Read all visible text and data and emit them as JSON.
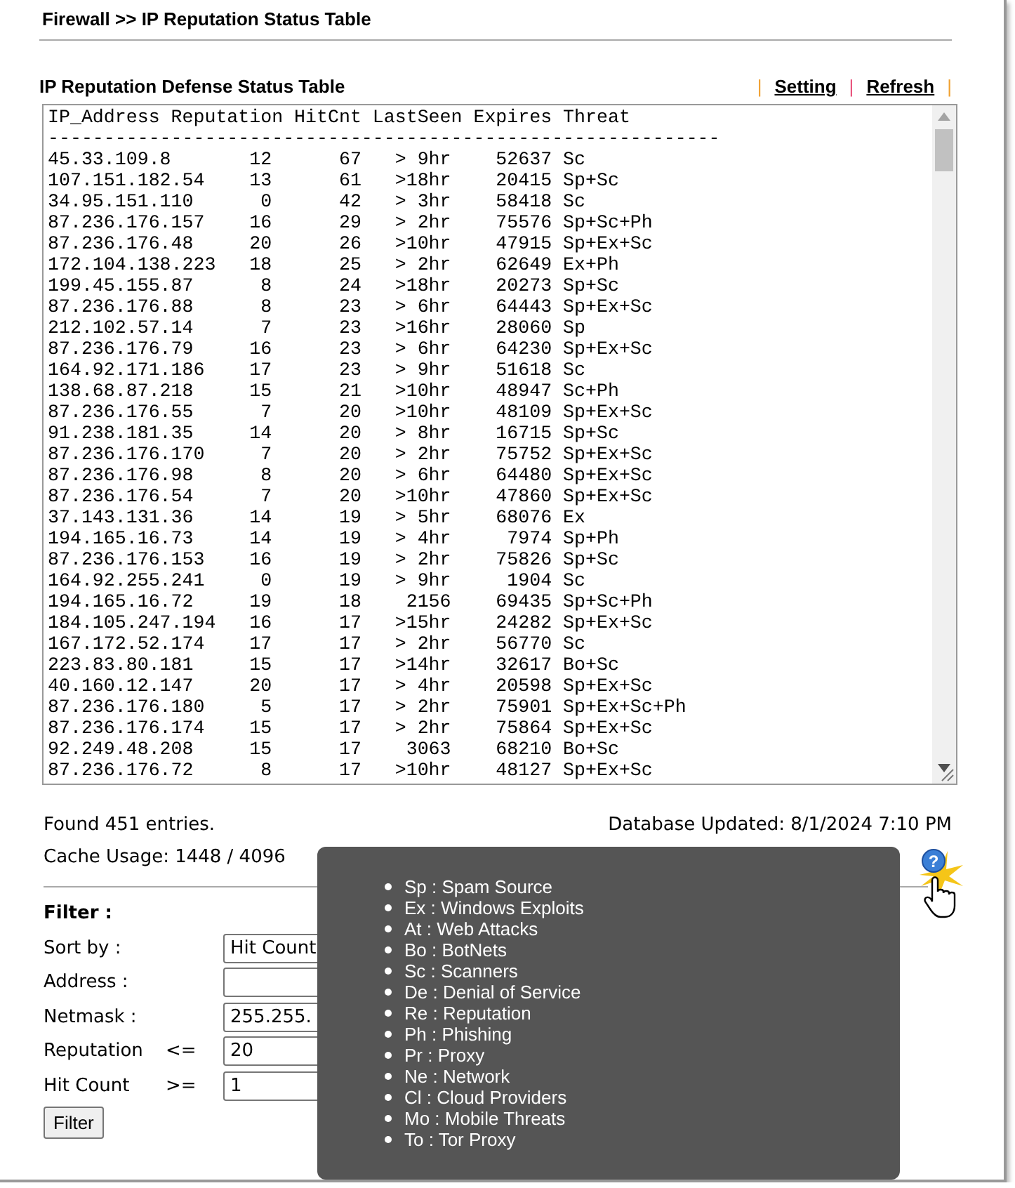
{
  "page_title": "Firewall >> IP Reputation Status Table",
  "section_title": "IP Reputation Defense Status Table",
  "toolbar": [
    {
      "kind": "separator",
      "text": "|",
      "color": "#f0a030"
    },
    {
      "kind": "link",
      "text": "Setting"
    },
    {
      "kind": "separator",
      "text": "|",
      "color": "#e8507a"
    },
    {
      "kind": "link",
      "text": "Refresh"
    },
    {
      "kind": "separator",
      "text": "|",
      "color": "#f0a030"
    }
  ],
  "table": {
    "header": "IP_Address Reputation HitCnt LastSeen Expires Threat",
    "separator": "------------------------------------------------------------",
    "rows": [
      [
        "45.33.109.8",
        "12",
        "67",
        "> 9hr",
        "52637",
        "Sc"
      ],
      [
        "107.151.182.54",
        "13",
        "61",
        ">18hr",
        "20415",
        "Sp+Sc"
      ],
      [
        "34.95.151.110",
        "0",
        "42",
        "> 3hr",
        "58418",
        "Sc"
      ],
      [
        "87.236.176.157",
        "16",
        "29",
        "> 2hr",
        "75576",
        "Sp+Sc+Ph"
      ],
      [
        "87.236.176.48",
        "20",
        "26",
        ">10hr",
        "47915",
        "Sp+Ex+Sc"
      ],
      [
        "172.104.138.223",
        "18",
        "25",
        "> 2hr",
        "62649",
        "Ex+Ph"
      ],
      [
        "199.45.155.87",
        "8",
        "24",
        ">18hr",
        "20273",
        "Sp+Sc"
      ],
      [
        "87.236.176.88",
        "8",
        "23",
        "> 6hr",
        "64443",
        "Sp+Ex+Sc"
      ],
      [
        "212.102.57.14",
        "7",
        "23",
        ">16hr",
        "28060",
        "Sp"
      ],
      [
        "87.236.176.79",
        "16",
        "23",
        "> 6hr",
        "64230",
        "Sp+Ex+Sc"
      ],
      [
        "164.92.171.186",
        "17",
        "23",
        "> 9hr",
        "51618",
        "Sc"
      ],
      [
        "138.68.87.218",
        "15",
        "21",
        ">10hr",
        "48947",
        "Sc+Ph"
      ],
      [
        "87.236.176.55",
        "7",
        "20",
        ">10hr",
        "48109",
        "Sp+Ex+Sc"
      ],
      [
        "91.238.181.35",
        "14",
        "20",
        "> 8hr",
        "16715",
        "Sp+Sc"
      ],
      [
        "87.236.176.170",
        "7",
        "20",
        "> 2hr",
        "75752",
        "Sp+Ex+Sc"
      ],
      [
        "87.236.176.98",
        "8",
        "20",
        "> 6hr",
        "64480",
        "Sp+Ex+Sc"
      ],
      [
        "87.236.176.54",
        "7",
        "20",
        ">10hr",
        "47860",
        "Sp+Ex+Sc"
      ],
      [
        "37.143.131.36",
        "14",
        "19",
        "> 5hr",
        "68076",
        "Ex"
      ],
      [
        "194.165.16.73",
        "14",
        "19",
        "> 4hr",
        "7974",
        "Sp+Ph"
      ],
      [
        "87.236.176.153",
        "16",
        "19",
        "> 2hr",
        "75826",
        "Sp+Sc"
      ],
      [
        "164.92.255.241",
        "0",
        "19",
        "> 9hr",
        "1904",
        "Sc"
      ],
      [
        "194.165.16.72",
        "19",
        "18",
        "2156",
        "69435",
        "Sp+Sc+Ph"
      ],
      [
        "184.105.247.194",
        "16",
        "17",
        ">15hr",
        "24282",
        "Sp+Ex+Sc"
      ],
      [
        "167.172.52.174",
        "17",
        "17",
        "> 2hr",
        "56770",
        "Sc"
      ],
      [
        "223.83.80.181",
        "15",
        "17",
        ">14hr",
        "32617",
        "Bo+Sc"
      ],
      [
        "40.160.12.147",
        "20",
        "17",
        "> 4hr",
        "20598",
        "Sp+Ex+Sc"
      ],
      [
        "87.236.176.180",
        "5",
        "17",
        "> 2hr",
        "75901",
        "Sp+Ex+Sc+Ph"
      ],
      [
        "87.236.176.174",
        "15",
        "17",
        "> 2hr",
        "75864",
        "Sp+Ex+Sc"
      ],
      [
        "92.249.48.208",
        "15",
        "17",
        "3063",
        "68210",
        "Bo+Sc"
      ],
      [
        "87.236.176.72",
        "8",
        "17",
        ">10hr",
        "48127",
        "Sp+Ex+Sc"
      ]
    ]
  },
  "found": "Found 451 entries.",
  "database_updated": "Database Updated: 8/1/2024 7:10 PM",
  "cache_usage": "Cache Usage: 1448 / 4096",
  "help_glyph": "?",
  "filter": {
    "title": "Filter :",
    "fields": [
      {
        "label": "Sort by :",
        "value": "Hit Count"
      },
      {
        "label": "Address :"
      },
      {
        "label": "Netmask :",
        "value": "255.255."
      },
      {
        "label": "Reputation",
        "operator": "<=",
        "value": "20"
      },
      {
        "label": "Hit Count",
        "operator": ">=",
        "value": "1"
      }
    ],
    "button": "Filter"
  },
  "legend": [
    "Sp : Spam Source",
    "Ex : Windows Exploits",
    "At : Web Attacks",
    "Bo : BotNets",
    "Sc : Scanners",
    "De : Denial of Service",
    "Re : Reputation",
    "Ph : Phishing",
    "Pr : Proxy",
    "Ne : Network",
    "Cl : Cloud Providers",
    "Mo : Mobile Threats",
    "To : Tor Proxy"
  ]
}
